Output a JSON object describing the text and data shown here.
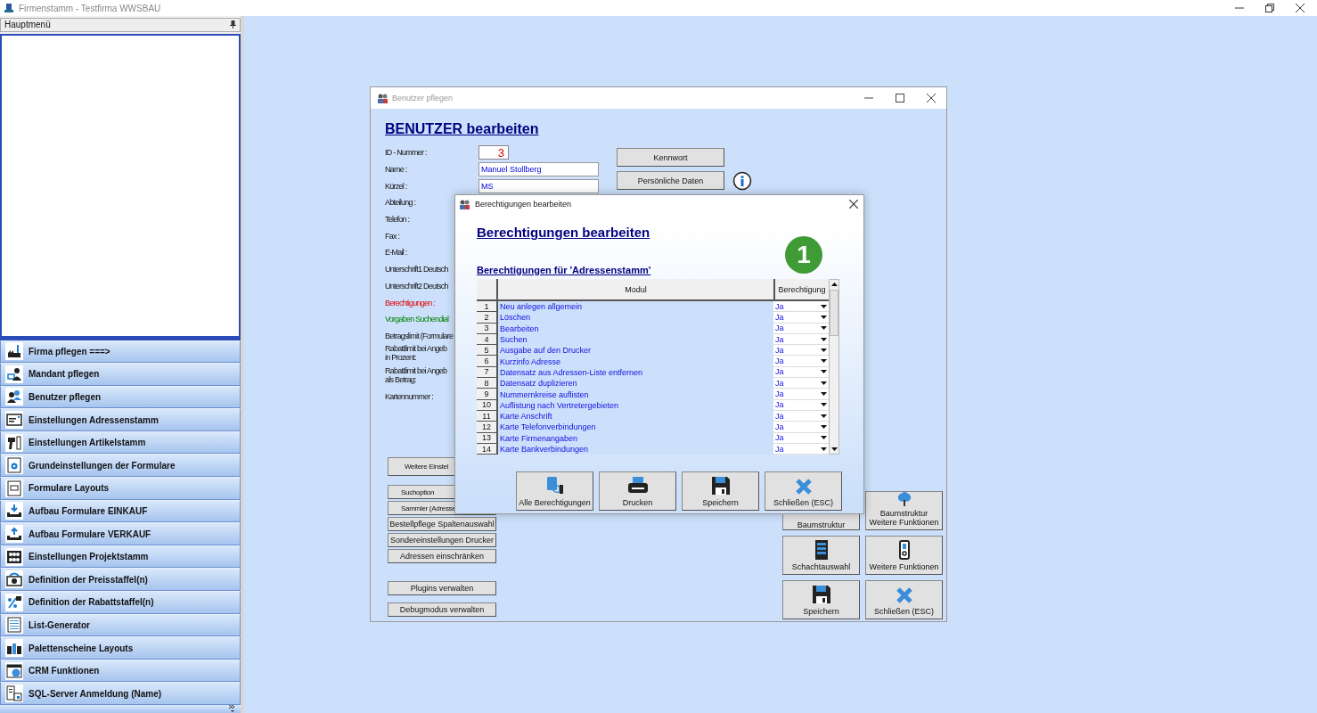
{
  "app": {
    "title": "Firmenstamm - Testfirma WWSBAU"
  },
  "sidebar": {
    "title": "Hauptmenü",
    "items": [
      {
        "label": "Firma pflegen   ===>"
      },
      {
        "label": "Mandant pflegen"
      },
      {
        "label": "Benutzer pflegen"
      },
      {
        "label": "Einstellungen Adressenstamm"
      },
      {
        "label": "Einstellungen Artikelstamm"
      },
      {
        "label": "Grundeinstellungen der Formulare"
      },
      {
        "label": "Formulare Layouts"
      },
      {
        "label": "Aufbau Formulare EINKAUF"
      },
      {
        "label": "Aufbau Formulare VERKAUF"
      },
      {
        "label": "Einstellungen Projektstamm"
      },
      {
        "label": "Definition der Preisstaffel(n)"
      },
      {
        "label": "Definition der Rabattstaffel(n)"
      },
      {
        "label": "List-Generator"
      },
      {
        "label": "Palettenscheine Layouts"
      },
      {
        "label": "CRM Funktionen"
      },
      {
        "label": "SQL-Server Anmeldung (Name)"
      }
    ]
  },
  "user_window": {
    "title": "Benutzer pflegen",
    "heading": "BENUTZER bearbeiten",
    "fields": [
      {
        "label": "ID - Nummer :",
        "kind": "id",
        "value": "3"
      },
      {
        "label": "Name :",
        "kind": "text",
        "value": "Manuel Stollberg"
      },
      {
        "label": "Kürzel :",
        "kind": "text",
        "value": "MS"
      },
      {
        "label": "Abteilung :",
        "kind": "label"
      },
      {
        "label": "Telefon :",
        "kind": "label"
      },
      {
        "label": "Fax :",
        "kind": "label"
      },
      {
        "label": "E-Mail :",
        "kind": "label"
      },
      {
        "label": "Unterschrift1 Deutsch",
        "kind": "label"
      },
      {
        "label": "Unterschrift2 Deutsch",
        "kind": "label"
      },
      {
        "label": "Berechtigungen :",
        "kind": "alert"
      },
      {
        "label": "Vorgaben Suchendial",
        "kind": "hint"
      },
      {
        "label": "Betragslimit (Formulare",
        "kind": "label"
      },
      {
        "label": "Rabattlimit bei Angeb\nin Prozent:",
        "kind": "label"
      },
      {
        "label": "Rabattlimit bei Angeb\nals Betrag:",
        "kind": "label"
      },
      {
        "label": "Kartennummer :",
        "kind": "label"
      }
    ],
    "side_buttons": [
      "Kennwort",
      "Persönliche Daten"
    ],
    "option_buttons": [
      {
        "label": "Weitere Einstel",
        "kind": "large"
      },
      {
        "label": "Suchoption",
        "kind": "cut"
      },
      {
        "label": "Sammler (Adresse",
        "kind": "cut"
      },
      {
        "label": "Bestellpflege Spaltenauswahl",
        "kind": "small"
      },
      {
        "label": "Sondereinstellungen Drucker",
        "kind": "small"
      },
      {
        "label": "Adressen einschränken",
        "kind": "small"
      },
      {
        "label": "Plugins verwalten",
        "kind": "spaced"
      },
      {
        "label": "Debugmodus verwalten",
        "kind": "small"
      }
    ],
    "covered_button": "Baumstruktur",
    "action_buttons": [
      {
        "label": "Baumstruktur\nWeitere Funktionen",
        "kind": "tree"
      },
      {
        "label": "Schachtauswahl",
        "kind": "rack"
      },
      {
        "label": "Weitere Funktionen",
        "kind": "device"
      },
      {
        "label": "Speichern",
        "kind": "save"
      },
      {
        "label": "Schließen (ESC)",
        "kind": "close"
      }
    ]
  },
  "dialog": {
    "title": "Berechtigungen bearbeiten",
    "heading": "Berechtigungen bearbeiten",
    "subheading": "Berechtigungen für 'Adressenstamm'",
    "badge": "1",
    "table": {
      "columns": [
        "Modul",
        "Berechtigung"
      ],
      "rows": [
        {
          "number": "1",
          "module": "Neu anlegen allgemein",
          "permission": "Ja"
        },
        {
          "number": "2",
          "module": "Löschen",
          "permission": "Ja"
        },
        {
          "number": "3",
          "module": "Bearbeiten",
          "permission": "Ja"
        },
        {
          "number": "4",
          "module": "Suchen",
          "permission": "Ja"
        },
        {
          "number": "5",
          "module": "Ausgabe auf den Drucker",
          "permission": "Ja"
        },
        {
          "number": "6",
          "module": "Kurzinfo Adresse",
          "permission": "Ja"
        },
        {
          "number": "7",
          "module": "Datensatz aus Adressen-Liste entfernen",
          "permission": "Ja"
        },
        {
          "number": "8",
          "module": "Datensatz duplizieren",
          "permission": "Ja"
        },
        {
          "number": "9",
          "module": "Nummernkreise auflisten",
          "permission": "Ja"
        },
        {
          "number": "10",
          "module": "Auflistung nach Vertretergebieten",
          "permission": "Ja"
        },
        {
          "number": "11",
          "module": "Karte Anschrift",
          "permission": "Ja"
        },
        {
          "number": "12",
          "module": "Karte Telefonverbindungen",
          "permission": "Ja"
        },
        {
          "number": "13",
          "module": "Karte Firmenangaben",
          "permission": "Ja"
        },
        {
          "number": "14",
          "module": "Karte Bankverbindungen",
          "permission": "Ja"
        }
      ]
    },
    "buttons": [
      {
        "label": "Alle Berechtigungen",
        "kind": "tablet"
      },
      {
        "label": "Drucken",
        "kind": "printer"
      },
      {
        "label": "Speichern",
        "kind": "save"
      },
      {
        "label": "Schließen (ESC)",
        "kind": "close"
      }
    ]
  }
}
